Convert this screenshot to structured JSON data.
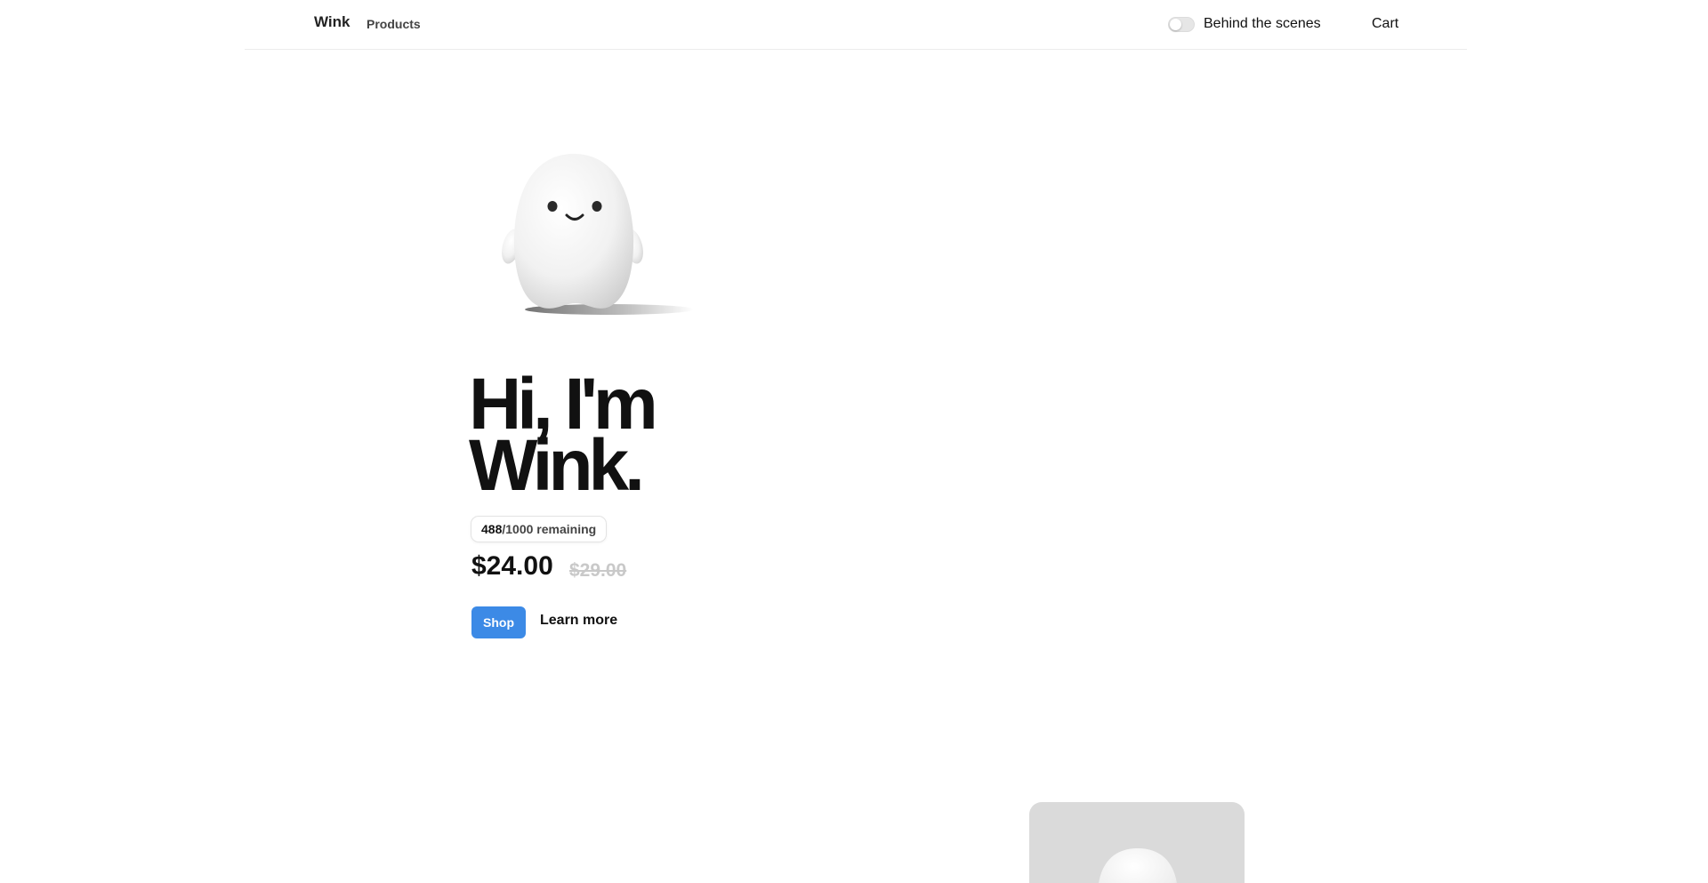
{
  "header": {
    "brand": "Wink",
    "nav": [
      {
        "label": "Products"
      }
    ],
    "behind_scenes_label": "Behind the scenes",
    "behind_scenes_on": false,
    "cart_label": "Cart"
  },
  "hero": {
    "headline_line1": "Hi, I'm",
    "headline_line2": "Wink.",
    "remaining_count": "488",
    "remaining_rest": "/1000 remaining",
    "price": "$24.00",
    "price_original": "$29.00",
    "shop_label": "Shop",
    "learn_more_label": "Learn more",
    "shop_button_color": "#3c8ae6"
  },
  "icons": {
    "mascot": "ghost-mascot-image",
    "card_image": "ghost-mascot-card-image"
  }
}
